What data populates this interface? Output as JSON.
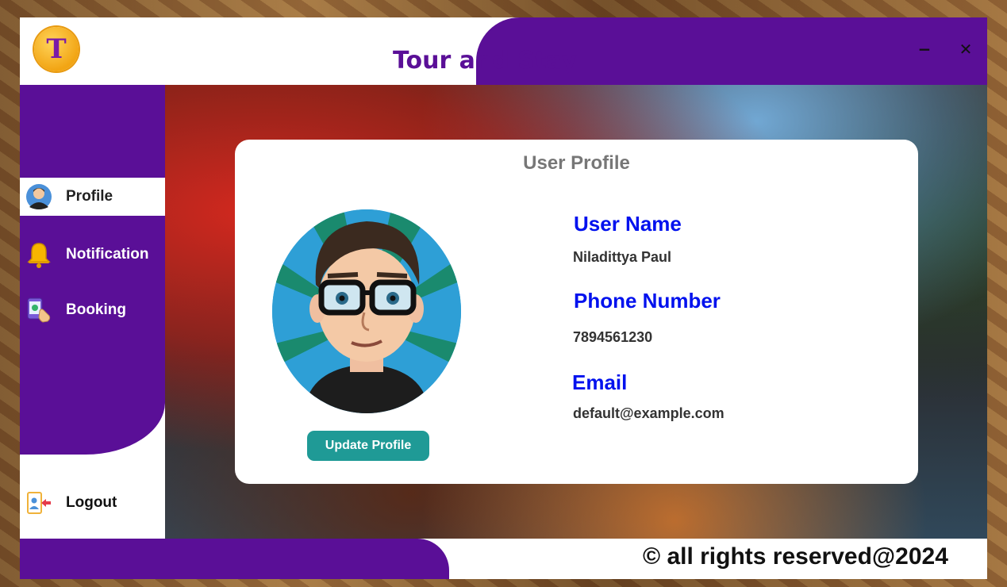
{
  "window": {
    "title": "Tour and Stay",
    "logo_letter": "T",
    "minimize_glyph": "−",
    "close_glyph": "✕"
  },
  "sidebar": {
    "items": [
      {
        "label": "Profile",
        "icon": "user-avatar-icon",
        "active": true
      },
      {
        "label": "Notification",
        "icon": "bell-icon",
        "active": false
      },
      {
        "label": "Booking",
        "icon": "booking-tap-icon",
        "active": false
      }
    ],
    "logout_label": "Logout"
  },
  "profile": {
    "card_title": "User Profile",
    "update_button": "Update Profile",
    "fields": [
      {
        "label": "User Name",
        "value": "Niladittya Paul"
      },
      {
        "label": "Phone Number",
        "value": "7894561230"
      },
      {
        "label": "Email",
        "value": "default@example.com"
      }
    ]
  },
  "footer": {
    "copyright": "© all rights reserved@2024"
  },
  "colors": {
    "brand_purple": "#5a0f97",
    "accent_teal": "#1f9a96",
    "label_blue": "#0011ee"
  }
}
